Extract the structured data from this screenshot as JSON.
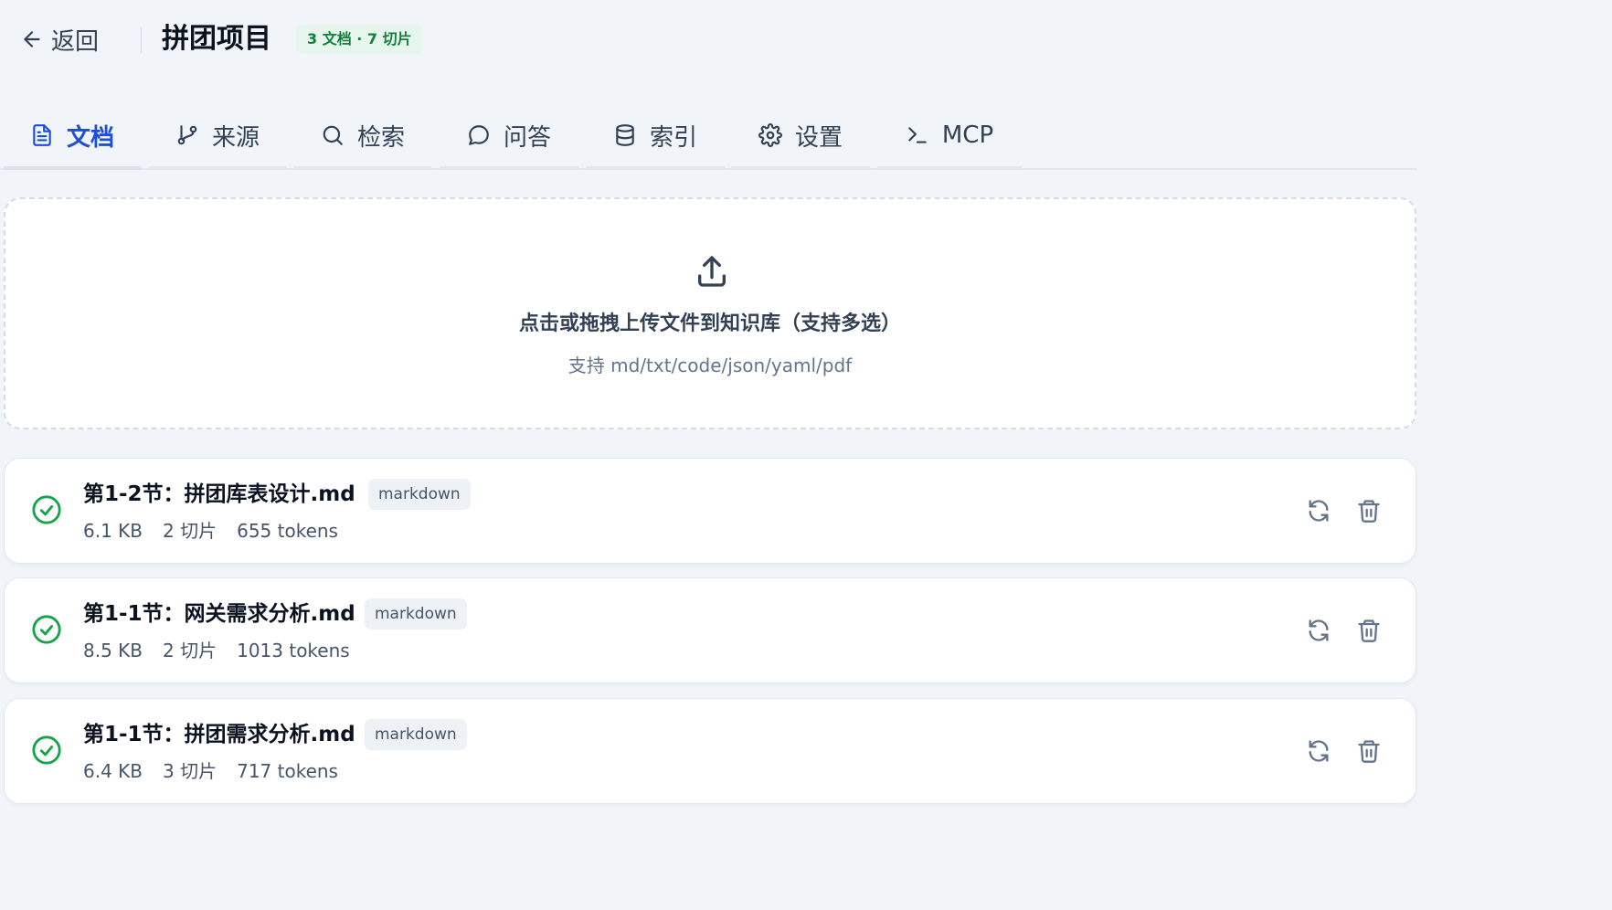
{
  "header": {
    "back_label": "返回",
    "project_title": "拼团项目",
    "stats_badge": "3 文档 · 7 切片"
  },
  "tabs": [
    {
      "label": "文档",
      "icon": "document-icon",
      "active": true
    },
    {
      "label": "来源",
      "icon": "git-branch-icon",
      "active": false
    },
    {
      "label": "检索",
      "icon": "search-icon",
      "active": false
    },
    {
      "label": "问答",
      "icon": "chat-bubble-icon",
      "active": false
    },
    {
      "label": "索引",
      "icon": "database-icon",
      "active": false
    },
    {
      "label": "设置",
      "icon": "gear-icon",
      "active": false
    },
    {
      "label": "MCP",
      "icon": "terminal-prompt-icon",
      "active": false
    }
  ],
  "upload": {
    "title": "点击或拖拽上传文件到知识库（支持多选）",
    "hint": "支持 md/txt/code/json/yaml/pdf"
  },
  "files": [
    {
      "name": "第1-2节：拼团库表设计.md",
      "type": "markdown",
      "size": "6.1 KB",
      "chunks": "2 切片",
      "tokens": "655 tokens",
      "status": "done"
    },
    {
      "name": "第1-1节：网关需求分析.md",
      "type": "markdown",
      "size": "8.5 KB",
      "chunks": "2 切片",
      "tokens": "1013 tokens",
      "status": "done"
    },
    {
      "name": "第1-1节：拼团需求分析.md",
      "type": "markdown",
      "size": "6.4 KB",
      "chunks": "3 切片",
      "tokens": "717 tokens",
      "status": "done"
    }
  ],
  "colors": {
    "accent": "#1d4ed8",
    "success": "#16a34a",
    "badge_bg": "#e6f6ec",
    "badge_text": "#15803d"
  }
}
